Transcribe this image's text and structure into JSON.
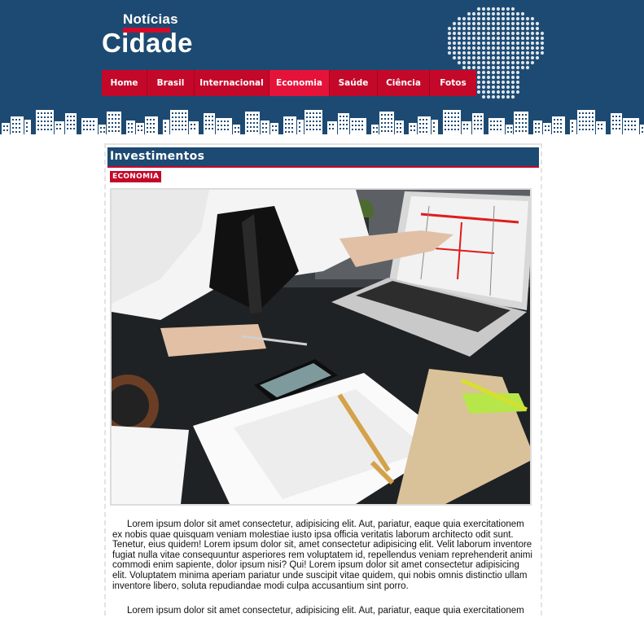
{
  "brand": {
    "top": "Notícias",
    "main": "Cidade"
  },
  "colors": {
    "header_bg": "#1d4a72",
    "nav_bg": "#c4082a",
    "nav_active": "#e5133a",
    "badge": "#c4082a"
  },
  "nav": {
    "items": [
      {
        "label": "Home"
      },
      {
        "label": "Brasil"
      },
      {
        "label": "Internacional"
      },
      {
        "label": "Economia",
        "active": true
      },
      {
        "label": "Saúde"
      },
      {
        "label": "Ciência"
      },
      {
        "label": "Fotos"
      }
    ]
  },
  "article": {
    "title": "Investimentos",
    "category": "ECONOMIA",
    "image_icon": "photo-office-laptop",
    "paragraphs": [
      "Lorem ipsum dolor sit amet consectetur, adipisicing elit. Aut, pariatur, eaque quia exercitationem ex nobis quae quisquam veniam molestiae iusto ipsa officia veritatis laborum architecto odit sunt. Tenetur, eius quidem! Lorem ipsum dolor sit, amet consectetur adipisicing elit. Velit laborum inventore fugiat nulla vitae consequuntur asperiores rem voluptatem id, repellendus veniam reprehenderit animi commodi enim sapiente, dolor ipsum nisi? Qui! Lorem ipsum dolor sit amet consectetur adipisicing elit. Voluptatem minima aperiam pariatur unde suscipit vitae quidem, qui nobis omnis distinctio ullam inventore libero, soluta repudiandae modi culpa accusantium sint porro.",
      "Lorem ipsum dolor sit amet consectetur, adipisicing elit. Aut, pariatur, eaque quia exercitationem"
    ]
  }
}
